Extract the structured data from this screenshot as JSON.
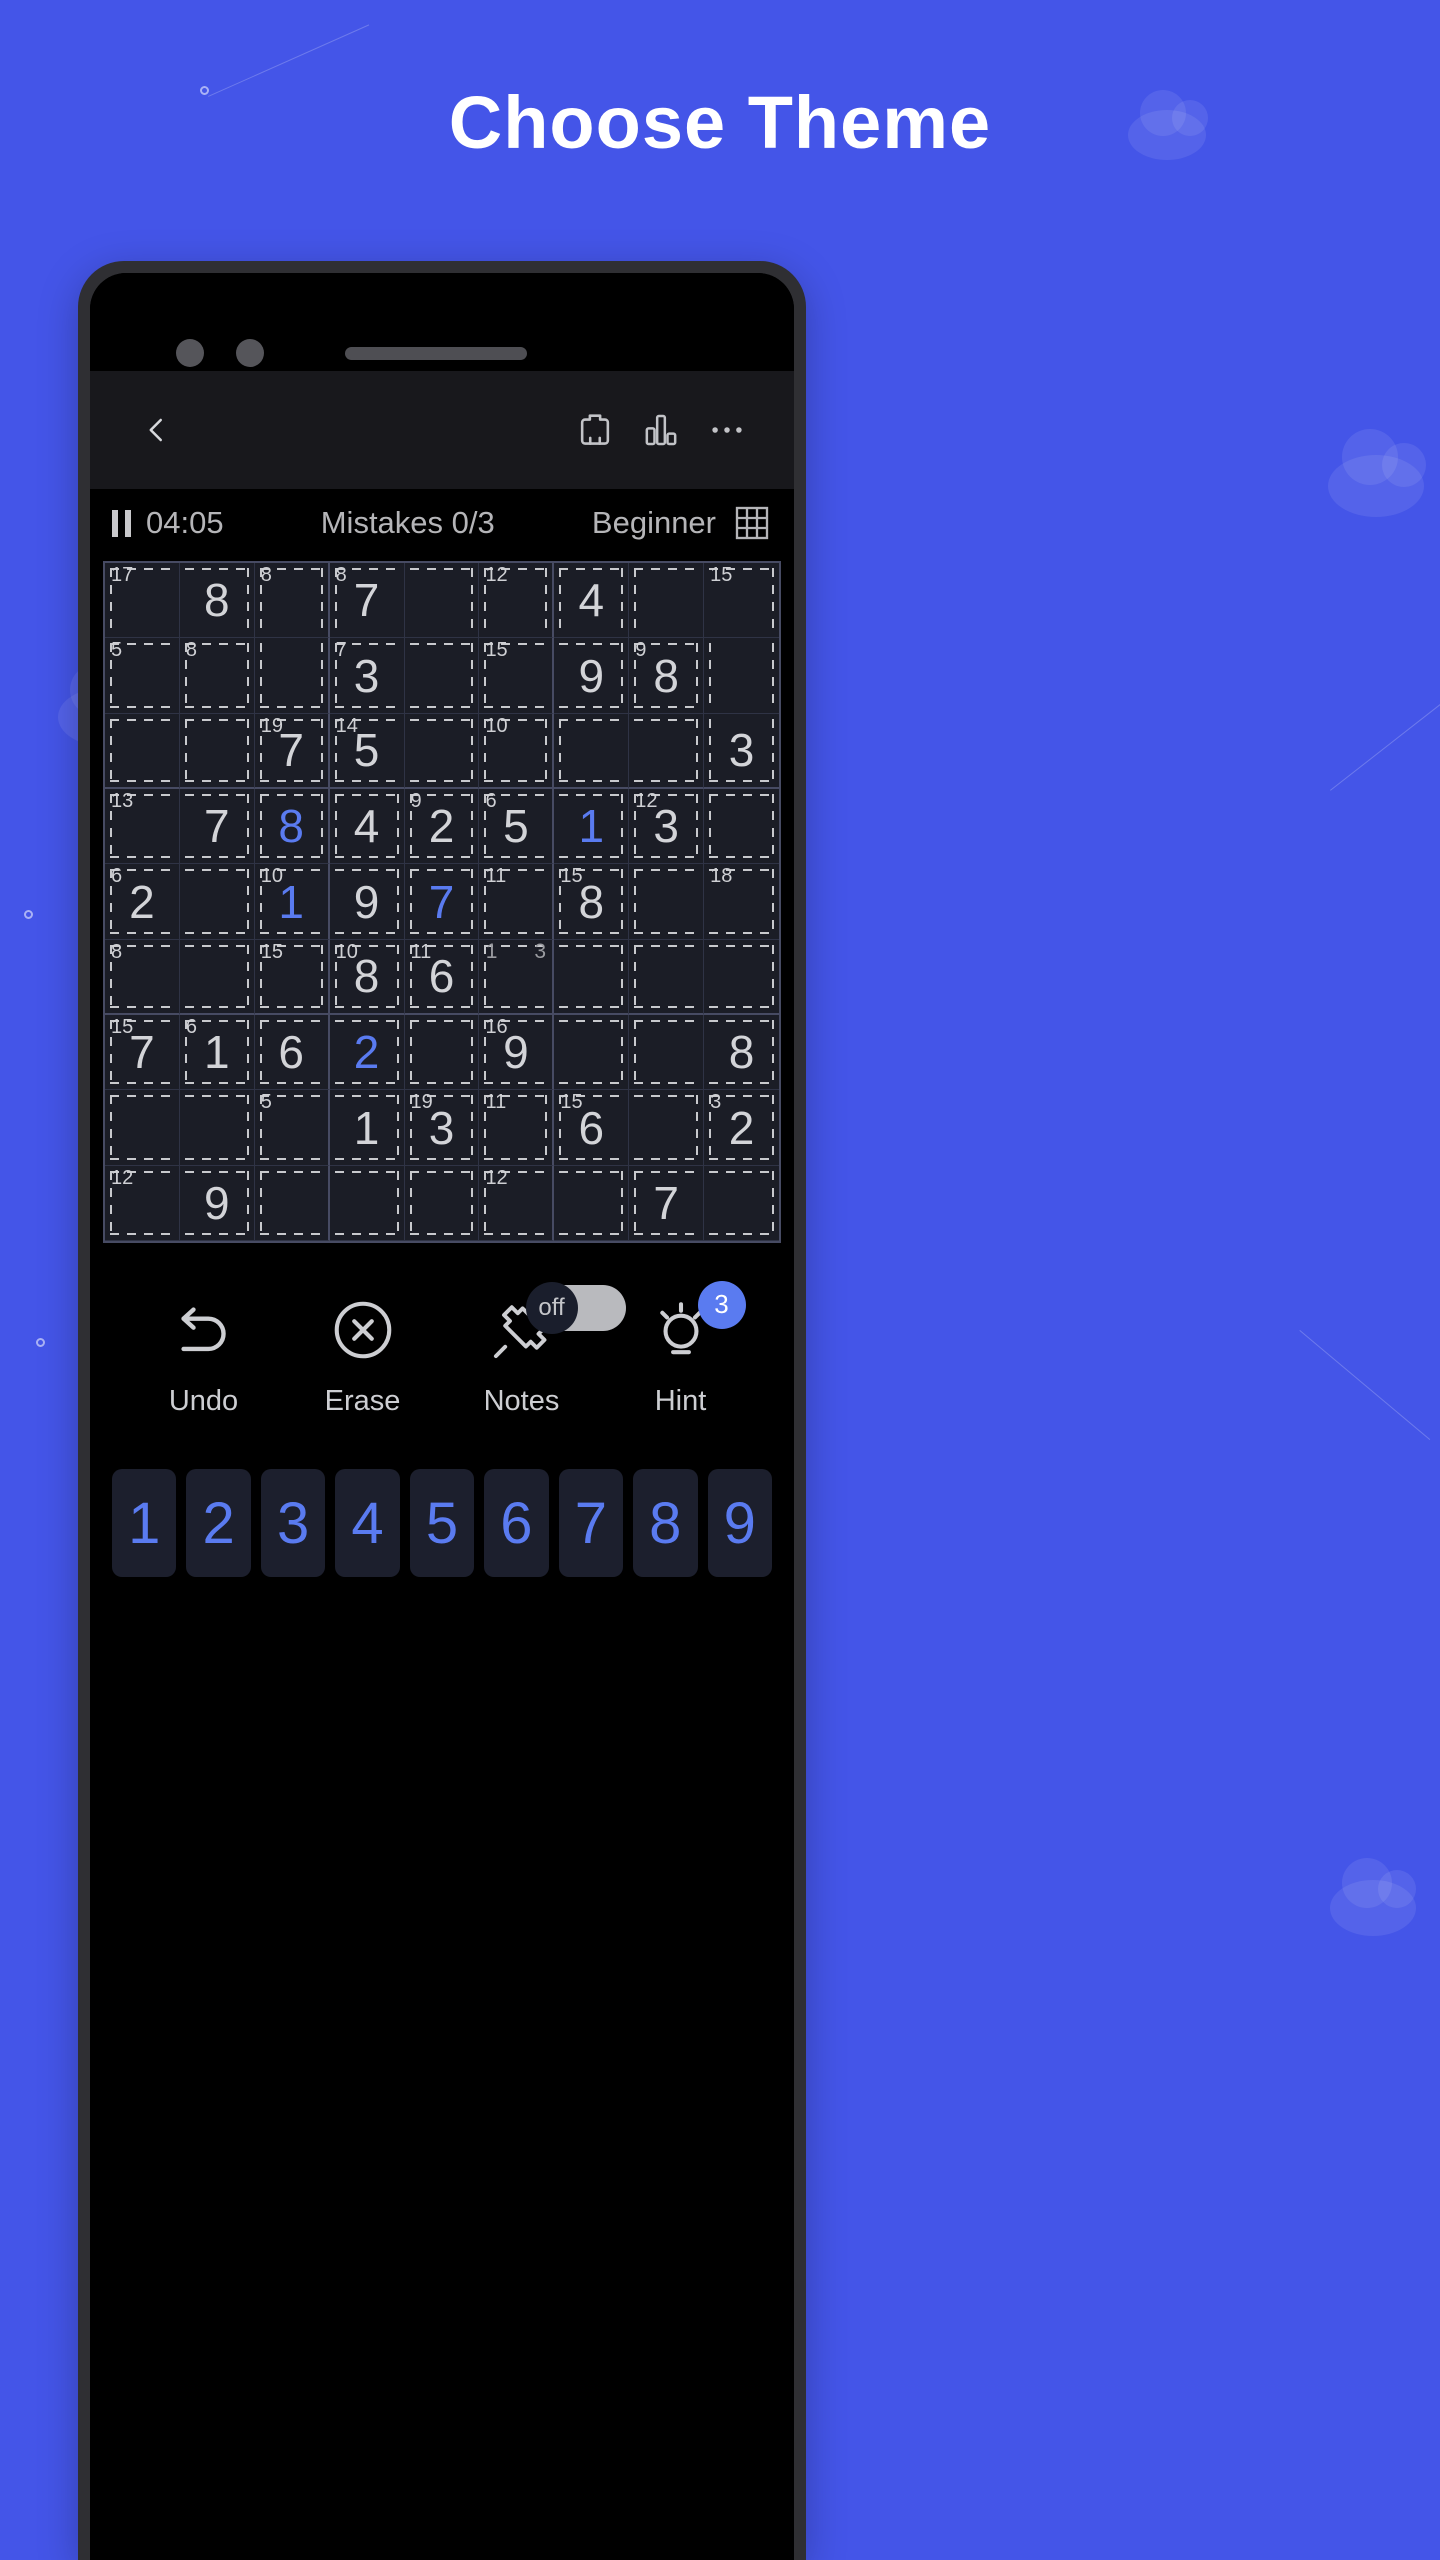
{
  "page": {
    "headline": "Choose Theme",
    "background_color": "#4455e8"
  },
  "app": {
    "topbar": {
      "back_label": "Back",
      "theme_icon": "theme-icon",
      "stats_icon": "statistics-icon",
      "more_icon": "more-options-icon"
    },
    "statusbar": {
      "pause_icon": "pause-icon",
      "timer": "04:05",
      "mistakes": "Mistakes 0/3",
      "difficulty": "Beginner",
      "grid_icon": "grid-icon"
    },
    "actions": [
      {
        "label": "Undo",
        "icon": "undo-icon"
      },
      {
        "label": "Erase",
        "icon": "erase-icon"
      },
      {
        "label": "Notes",
        "icon": "notes-icon",
        "toggle_state": "off"
      },
      {
        "label": "Hint",
        "icon": "hint-icon",
        "badge": "3"
      }
    ],
    "numpad": [
      "1",
      "2",
      "3",
      "4",
      "5",
      "6",
      "7",
      "8",
      "9"
    ],
    "colors": {
      "accent": "#5a7bf0",
      "board_bg": "#1b1d26",
      "given_text": "#d3d4d8",
      "user_text": "#5a7bf0",
      "screen_bg": "#000000",
      "topbar_bg": "#18181c"
    }
  },
  "board": {
    "type": "killer-sudoku",
    "size": 9,
    "cells": [
      [
        {
          "v": "",
          "s": "17",
          "c": "tl"
        },
        {
          "v": "8",
          "s": "",
          "c": "tr"
        },
        {
          "v": "",
          "s": "8",
          "c": "tlr"
        },
        {
          "v": "7",
          "s": "8",
          "c": "tl"
        },
        {
          "v": "",
          "s": "",
          "c": "tr"
        },
        {
          "v": "",
          "s": "12",
          "c": "tlr"
        },
        {
          "v": "4",
          "s": "",
          "c": "tlr"
        },
        {
          "v": "",
          "s": "",
          "c": "tl"
        },
        {
          "v": "",
          "s": "15",
          "c": "tr"
        }
      ],
      [
        {
          "v": "",
          "s": "5",
          "c": "tlb"
        },
        {
          "v": "",
          "s": "8",
          "c": "tlrb"
        },
        {
          "v": "",
          "s": "",
          "c": "lrb"
        },
        {
          "v": "3",
          "s": "7",
          "c": "tlb"
        },
        {
          "v": "",
          "s": "",
          "c": "trb"
        },
        {
          "v": "",
          "s": "15",
          "c": "tlb"
        },
        {
          "v": "9",
          "s": "",
          "c": "trb"
        },
        {
          "v": "8",
          "s": "9",
          "c": "tlrb"
        },
        {
          "v": "",
          "s": "",
          "c": "lr"
        }
      ],
      [
        {
          "v": "",
          "s": "",
          "c": "tlb"
        },
        {
          "v": "",
          "s": "",
          "c": "tlrb"
        },
        {
          "v": "7",
          "s": "19",
          "c": "tlrb"
        },
        {
          "v": "5",
          "s": "14",
          "c": "tlb"
        },
        {
          "v": "",
          "s": "",
          "c": "trb"
        },
        {
          "v": "",
          "s": "10",
          "c": "tlrb"
        },
        {
          "v": "",
          "s": "",
          "c": "tlb"
        },
        {
          "v": "",
          "s": "",
          "c": "trb"
        },
        {
          "v": "3",
          "s": "",
          "c": "lrb"
        }
      ],
      [
        {
          "v": "",
          "s": "13",
          "c": "tlb"
        },
        {
          "v": "7",
          "s": "",
          "c": "trb"
        },
        {
          "v": "8",
          "s": "",
          "c": "tlrb",
          "u": true
        },
        {
          "v": "4",
          "s": "",
          "c": "tlrb"
        },
        {
          "v": "2",
          "s": "9",
          "c": "tlrb"
        },
        {
          "v": "5",
          "s": "6",
          "c": "tlb"
        },
        {
          "v": "1",
          "s": "",
          "c": "trb",
          "u": true
        },
        {
          "v": "3",
          "s": "12",
          "c": "tlrb"
        },
        {
          "v": "",
          "s": "",
          "c": "tlrb"
        }
      ],
      [
        {
          "v": "2",
          "s": "6",
          "c": "tlb"
        },
        {
          "v": "",
          "s": "",
          "c": "trb"
        },
        {
          "v": "1",
          "s": "10",
          "c": "tlb",
          "u": true
        },
        {
          "v": "9",
          "s": "",
          "c": "trb"
        },
        {
          "v": "7",
          "s": "",
          "c": "tlrb",
          "u": true
        },
        {
          "v": "",
          "s": "11",
          "c": "tlb"
        },
        {
          "v": "8",
          "s": "15",
          "c": "tlrb"
        },
        {
          "v": "",
          "s": "",
          "c": "tlb"
        },
        {
          "v": "",
          "s": "18",
          "c": "trb"
        }
      ],
      [
        {
          "v": "",
          "s": "8",
          "c": "tlb"
        },
        {
          "v": "",
          "s": "",
          "c": "trb"
        },
        {
          "v": "",
          "s": "15",
          "c": "tlrb"
        },
        {
          "v": "8",
          "s": "10",
          "c": "tlrb"
        },
        {
          "v": "6",
          "s": "11",
          "c": "tlrb"
        },
        {
          "v": "",
          "s": "",
          "c": "tlb",
          "n": [
            "1",
            "",
            "3"
          ]
        },
        {
          "v": "",
          "s": "",
          "c": "trb"
        },
        {
          "v": "",
          "s": "",
          "c": "tlb"
        },
        {
          "v": "",
          "s": "",
          "c": "trb"
        }
      ],
      [
        {
          "v": "7",
          "s": "15",
          "c": "tlb"
        },
        {
          "v": "1",
          "s": "6",
          "c": "tlrb"
        },
        {
          "v": "6",
          "s": "",
          "c": "tlb"
        },
        {
          "v": "2",
          "s": "",
          "c": "trb",
          "u": true
        },
        {
          "v": "",
          "s": "",
          "c": "tlrb"
        },
        {
          "v": "9",
          "s": "16",
          "c": "tlb"
        },
        {
          "v": "",
          "s": "",
          "c": "trb"
        },
        {
          "v": "",
          "s": "",
          "c": "tlb"
        },
        {
          "v": "8",
          "s": "",
          "c": "trb"
        }
      ],
      [
        {
          "v": "",
          "s": "",
          "c": "tlb"
        },
        {
          "v": "",
          "s": "",
          "c": "trb"
        },
        {
          "v": "",
          "s": "5",
          "c": "tlb"
        },
        {
          "v": "1",
          "s": "",
          "c": "trb"
        },
        {
          "v": "3",
          "s": "19",
          "c": "tlrb"
        },
        {
          "v": "",
          "s": "11",
          "c": "tlrb"
        },
        {
          "v": "6",
          "s": "15",
          "c": "tlb"
        },
        {
          "v": "",
          "s": "",
          "c": "trb"
        },
        {
          "v": "2",
          "s": "3",
          "c": "tlrb"
        }
      ],
      [
        {
          "v": "",
          "s": "12",
          "c": "tlb"
        },
        {
          "v": "9",
          "s": "",
          "c": "trb"
        },
        {
          "v": "",
          "s": "",
          "c": "tlb"
        },
        {
          "v": "",
          "s": "",
          "c": "trb"
        },
        {
          "v": "",
          "s": "",
          "c": "tlrb"
        },
        {
          "v": "",
          "s": "12",
          "c": "tlb"
        },
        {
          "v": "",
          "s": "",
          "c": "trb"
        },
        {
          "v": "7",
          "s": "",
          "c": "tlb"
        },
        {
          "v": "",
          "s": "",
          "c": "trb"
        }
      ]
    ]
  }
}
